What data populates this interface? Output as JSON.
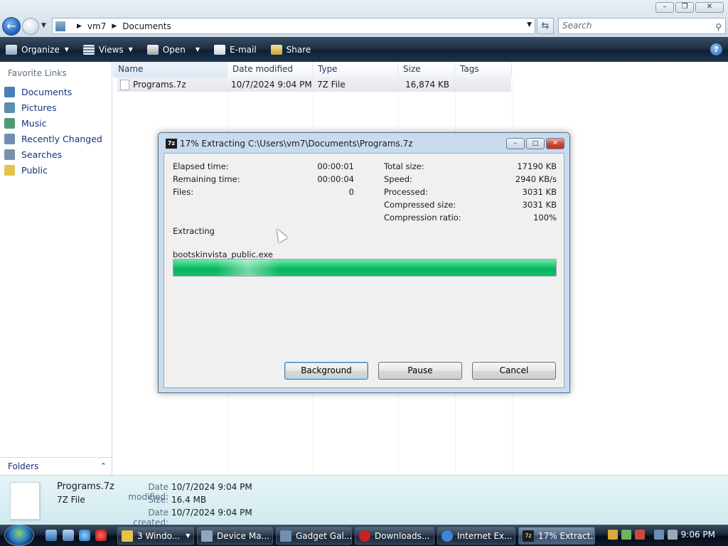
{
  "explorer": {
    "window_controls": [
      "minimize",
      "maximize",
      "close"
    ],
    "breadcrumb": [
      "vm7",
      "Documents"
    ],
    "search_placeholder": "Search",
    "toolbar": {
      "organize": "Organize",
      "views": "Views",
      "open": "Open",
      "email": "E-mail",
      "share": "Share"
    },
    "favorite_links_title": "Favorite Links",
    "favorite_links": [
      {
        "label": "Documents",
        "icon": "documents-icon",
        "color": "#4a7fb5"
      },
      {
        "label": "Pictures",
        "icon": "pictures-icon",
        "color": "#5b8fb0"
      },
      {
        "label": "Music",
        "icon": "music-icon",
        "color": "#4d9c73"
      },
      {
        "label": "Recently Changed",
        "icon": "recently-changed-icon",
        "color": "#6f8fb3"
      },
      {
        "label": "Searches",
        "icon": "searches-icon",
        "color": "#7b91a8"
      },
      {
        "label": "Public",
        "icon": "public-folder-icon",
        "color": "#e8c14d"
      }
    ],
    "folders_label": "Folders",
    "columns": [
      "Name",
      "Date modified",
      "Type",
      "Size",
      "Tags"
    ],
    "files": [
      {
        "name": "Programs.7z",
        "date_modified": "10/7/2024 9:04 PM",
        "type": "7Z File",
        "size": "16,874 KB",
        "tags": ""
      }
    ]
  },
  "dialog": {
    "app_icon": "7z",
    "title": "17% Extracting C:\\Users\\vm7\\Documents\\Programs.7z",
    "left_stats": [
      {
        "label": "Elapsed time:",
        "value": "00:00:01"
      },
      {
        "label": "Remaining time:",
        "value": "00:00:04"
      },
      {
        "label": "Files:",
        "value": "0"
      }
    ],
    "right_stats": [
      {
        "label": "Total size:",
        "value": "17190 KB"
      },
      {
        "label": "Speed:",
        "value": "2940 KB/s"
      },
      {
        "label": "Processed:",
        "value": "3031 KB"
      },
      {
        "label": "Compressed size:",
        "value": "3031 KB"
      },
      {
        "label": "Compression ratio:",
        "value": "100%"
      }
    ],
    "status": "Extracting",
    "current_file": "bootskinvista_public.exe",
    "progress": 1.0,
    "buttons": {
      "background": "Background",
      "pause": "Pause",
      "cancel": "Cancel"
    }
  },
  "details_pane": {
    "name": "Programs.7z",
    "type": "7Z File",
    "date_modified_label": "Date modified:",
    "date_modified": "10/7/2024 9:04 PM",
    "size_label": "Size:",
    "size": "16.4 MB",
    "date_created_label": "Date created:",
    "date_created": "10/7/2024 9:04 PM"
  },
  "taskbar": {
    "tasks": [
      {
        "label": "3 Windo...",
        "icon": "folder-icon",
        "color": "#e8c14d",
        "active": false
      },
      {
        "label": "Device Ma...",
        "icon": "device-manager-icon",
        "color": "#8fa6bd",
        "active": false
      },
      {
        "label": "Gadget Gal...",
        "icon": "gadget-gallery-icon",
        "color": "#6f8fb3",
        "active": false
      },
      {
        "label": "Downloads...",
        "icon": "opera-icon",
        "color": "#cc1f1f",
        "active": false
      },
      {
        "label": "Internet Ex...",
        "icon": "internet-explorer-icon",
        "color": "#3c86d6",
        "active": false
      },
      {
        "label": "17% Extract...",
        "icon": "7zip-icon",
        "color": "#1c1c1c",
        "active": true
      }
    ],
    "clock": "9:06 PM"
  }
}
